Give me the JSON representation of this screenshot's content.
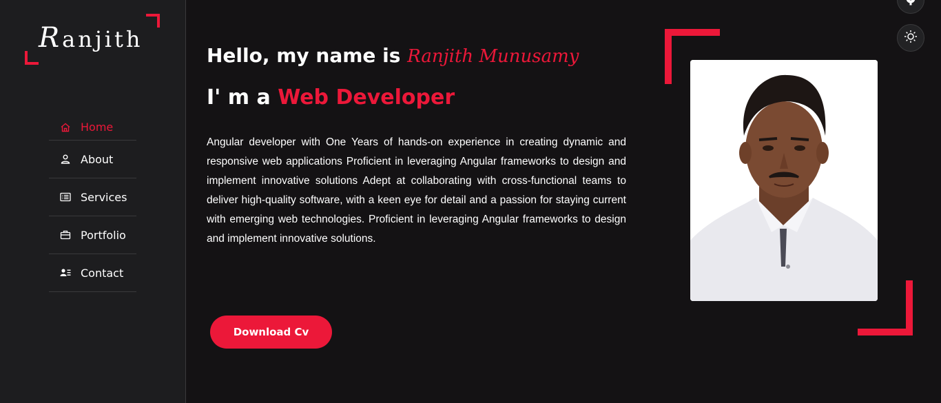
{
  "sidebar": {
    "logo": {
      "first": "R",
      "rest": "anjith"
    },
    "items": [
      {
        "label": "Home",
        "icon": "home-icon",
        "active": true
      },
      {
        "label": "About",
        "icon": "user-icon",
        "active": false
      },
      {
        "label": "Services",
        "icon": "list-icon",
        "active": false
      },
      {
        "label": "Portfolio",
        "icon": "briefcase-icon",
        "active": false
      },
      {
        "label": "Contact",
        "icon": "contacts-icon",
        "active": false
      }
    ]
  },
  "hero": {
    "greeting": "Hello, my name is ",
    "name": "Ranjith Munusamy",
    "role_prefix": "I' m a ",
    "role": "Web Developer",
    "description": "Angular developer with One Years of hands-on experience in creating dynamic and responsive web applications Proficient in leveraging Angular frameworks to design and implement innovative solutions Adept at collaborating with cross-functional teams to deliver high-quality software, with a keen eye for detail and a passion for staying current with emerging web technologies. Proficient in leveraging Angular frameworks to design and implement innovative solutions.",
    "cv_button": "Download Cv"
  },
  "floating": {
    "settings_icon": "gear-icon",
    "theme_icon": "sun-icon"
  },
  "colors": {
    "accent": "#ec1839",
    "background": "#141214",
    "sidebar": "#1d1d1f"
  }
}
